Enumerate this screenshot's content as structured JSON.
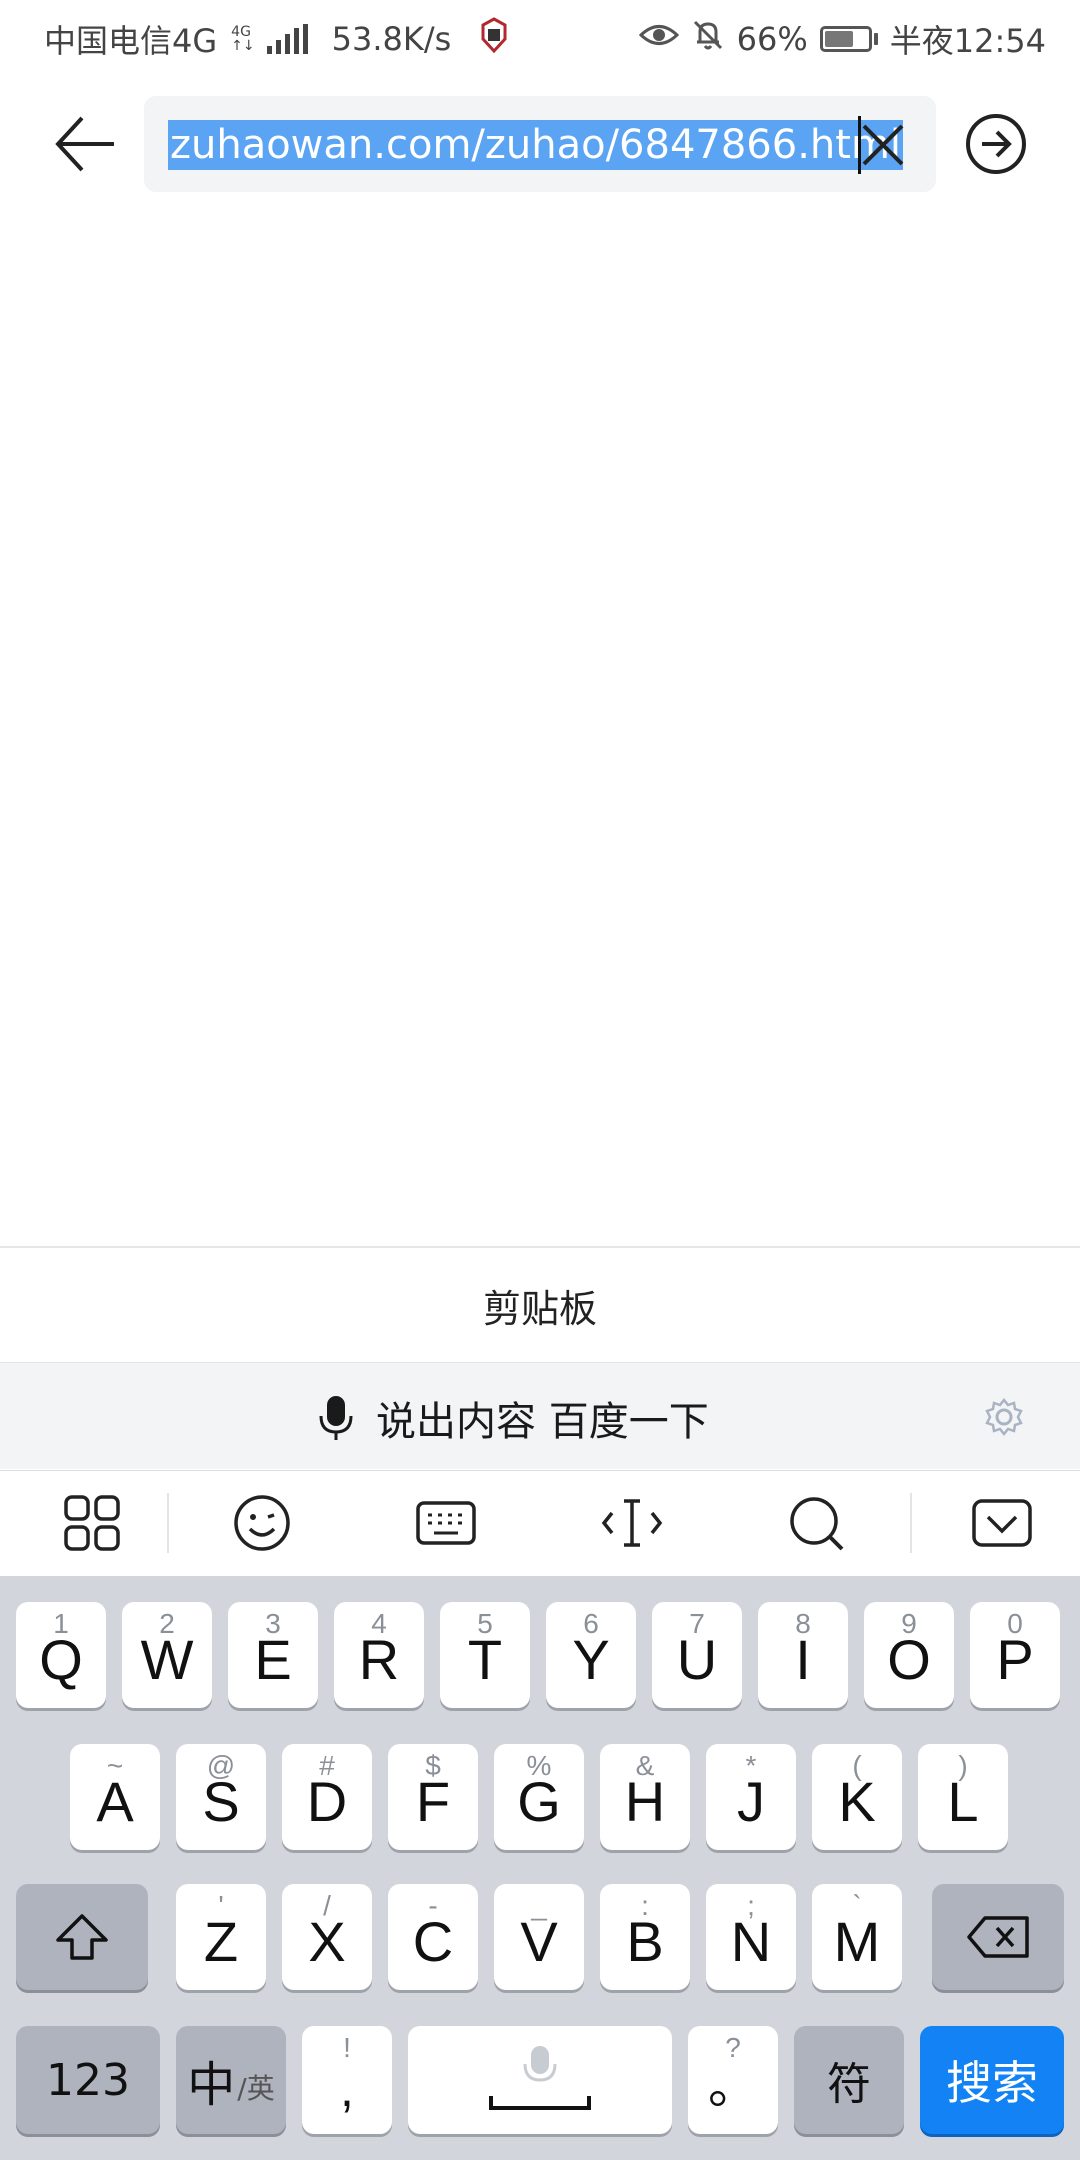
{
  "status_bar": {
    "carrier": "中国电信4G",
    "net_type_top": "4G",
    "net_type_bottom": "↑↓",
    "speed": "53.8K/s",
    "battery": "66%",
    "battery_level": 0.66,
    "time": "半夜12:54"
  },
  "url_bar": {
    "url": "zuhaowan.com/zuhao/6847866.html"
  },
  "clipboard": {
    "label": "剪贴板"
  },
  "voice_bar": {
    "label": "说出内容 百度一下"
  },
  "keyboard": {
    "row1": [
      {
        "hint": "1",
        "key": "Q"
      },
      {
        "hint": "2",
        "key": "W"
      },
      {
        "hint": "3",
        "key": "E"
      },
      {
        "hint": "4",
        "key": "R"
      },
      {
        "hint": "5",
        "key": "T"
      },
      {
        "hint": "6",
        "key": "Y"
      },
      {
        "hint": "7",
        "key": "U"
      },
      {
        "hint": "8",
        "key": "I"
      },
      {
        "hint": "9",
        "key": "O"
      },
      {
        "hint": "0",
        "key": "P"
      }
    ],
    "row2": [
      {
        "hint": "~",
        "key": "A"
      },
      {
        "hint": "@",
        "key": "S"
      },
      {
        "hint": "#",
        "key": "D"
      },
      {
        "hint": "$",
        "key": "F"
      },
      {
        "hint": "%",
        "key": "G"
      },
      {
        "hint": "&",
        "key": "H"
      },
      {
        "hint": "*",
        "key": "J"
      },
      {
        "hint": "(",
        "key": "K"
      },
      {
        "hint": ")",
        "key": "L"
      }
    ],
    "row3": [
      {
        "hint": "'",
        "key": "Z"
      },
      {
        "hint": "/",
        "key": "X"
      },
      {
        "hint": "-",
        "key": "C"
      },
      {
        "hint": "_",
        "key": "V"
      },
      {
        "hint": ":",
        "key": "B"
      },
      {
        "hint": ";",
        "key": "N"
      },
      {
        "hint": "`",
        "key": "M"
      }
    ],
    "bottom": {
      "num_label": "123",
      "lang_main": "中",
      "lang_sub": "/英",
      "comma_hint": "!",
      "comma_key": ",",
      "period_hint": "?",
      "period_key": "。",
      "symbol_label": "符",
      "search_label": "搜索"
    }
  },
  "colors": {
    "accent_blue": "#1282f5",
    "selection": "#5aa4f3",
    "keyboard_bg": "#d2d5db"
  },
  "icons": {
    "back": "arrow-left-icon",
    "clear": "close-icon",
    "go": "arrow-circle-right-icon",
    "mic": "microphone-icon",
    "settings": "gear-icon",
    "grid": "grid-icon",
    "emoji": "emoji-icon",
    "keyboard": "keyboard-icon",
    "cursor": "cursor-move-icon",
    "search": "search-icon",
    "hide_keyboard": "keyboard-hide-icon",
    "shift": "shift-icon",
    "backspace": "backspace-icon",
    "space": "space-icon"
  }
}
